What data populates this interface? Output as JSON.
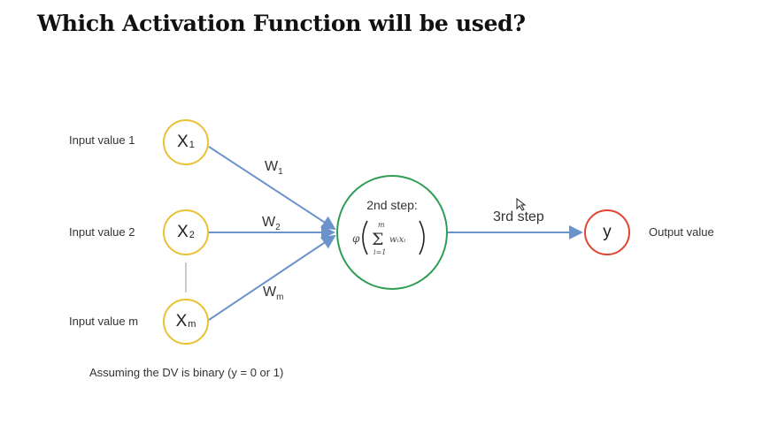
{
  "title": "Which Activation Function will be used?",
  "inputs": [
    {
      "label": "Input value 1",
      "node": "X",
      "sub": "1",
      "weight": "W",
      "weight_sub": "1"
    },
    {
      "label": "Input value 2",
      "node": "X",
      "sub": "2",
      "weight": "W",
      "weight_sub": "2"
    },
    {
      "label": "Input value m",
      "node": "X",
      "sub": "m",
      "weight": "W",
      "weight_sub": "m"
    }
  ],
  "neuron": {
    "label": "2nd step:",
    "formula": {
      "phi": "φ",
      "sigma": "Σ",
      "upper": "m",
      "lower": "i=1",
      "term": "wᵢxᵢ"
    }
  },
  "output": {
    "step_label": "3rd step",
    "node": "y",
    "label": "Output value"
  },
  "note": "Assuming the DV is binary (y = 0 or 1)",
  "colors": {
    "input_node": "#e9c233",
    "neuron": "#2e9e55",
    "output_node": "#e04433",
    "connector": "#6a93cc"
  }
}
